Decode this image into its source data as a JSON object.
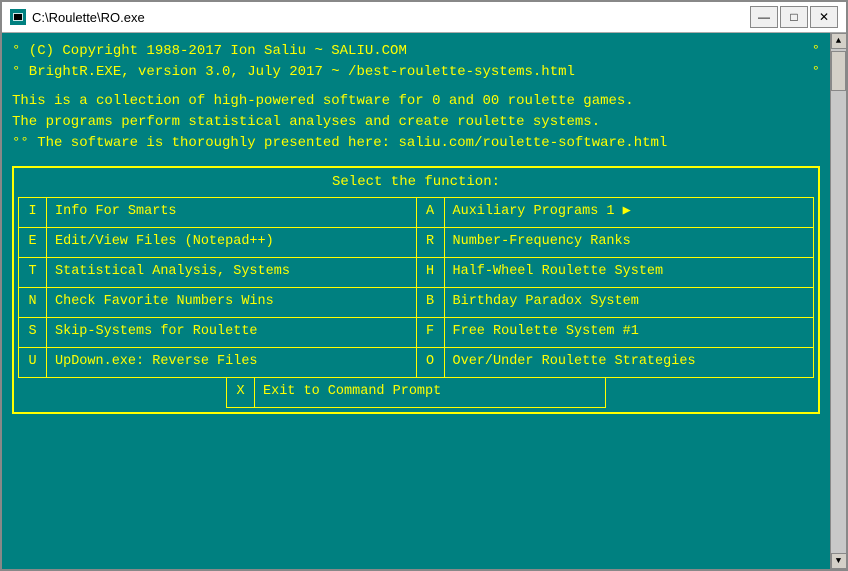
{
  "window": {
    "title": "C:\\Roulette\\RO.exe",
    "min_label": "—",
    "max_label": "□",
    "close_label": "✕"
  },
  "console": {
    "header": [
      {
        "left": "° (C) Copyright 1988-2017 Ion Saliu ~ SALIU.COM",
        "right": "°"
      },
      {
        "left": "° BrightR.EXE, version 3.0, July 2017 ~ /best-roulette-systems.html",
        "right": "°"
      }
    ],
    "desc": [
      "This is a collection of high-powered software for 0 and 00 roulette games.",
      "The programs perform statistical analyses and create roulette systems.",
      "°° The software is thoroughly presented here: saliu.com/roulette-software.html"
    ],
    "menu": {
      "title": "Select the function:",
      "items": [
        {
          "key": "I",
          "label": "Info For Smarts",
          "key2": "A",
          "label2": "Auxiliary Programs 1 ▶"
        },
        {
          "key": "E",
          "label": "Edit/View Files (Notepad++)",
          "key2": "R",
          "label2": "Number-Frequency Ranks"
        },
        {
          "key": "T",
          "label": "Statistical Analysis, Systems",
          "key2": "H",
          "label2": "Half-Wheel Roulette System"
        },
        {
          "key": "N",
          "label": "Check Favorite Numbers Wins",
          "key2": "B",
          "label2": "Birthday Paradox System"
        },
        {
          "key": "S",
          "label": "Skip-Systems for Roulette",
          "key2": "F",
          "label2": "Free Roulette System #1"
        },
        {
          "key": "U",
          "label": "UpDown.exe: Reverse Files",
          "key2": "O",
          "label2": "Over/Under Roulette Strategies"
        }
      ],
      "footer": {
        "key": "X",
        "label": "Exit to Command Prompt"
      }
    }
  }
}
